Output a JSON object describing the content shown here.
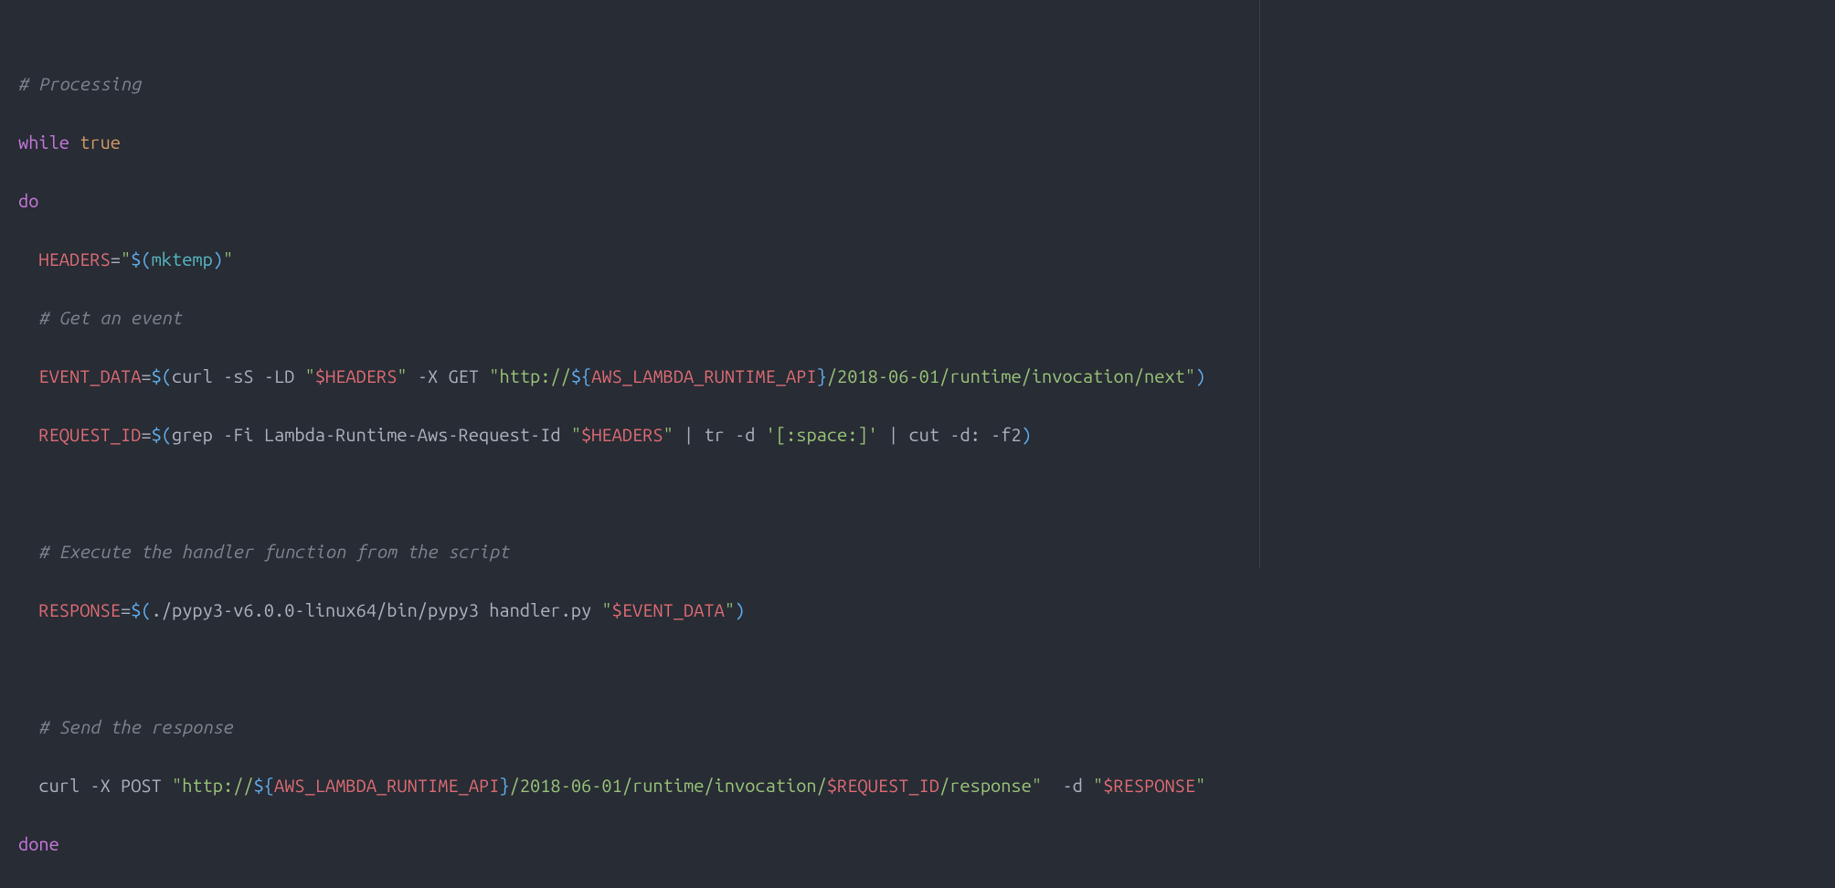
{
  "code": {
    "l1_comment": "# Processing",
    "l2_while": "while",
    "l2_true": "true",
    "l3_do": "do",
    "l4_var": "HEADERS",
    "l4_eq": "=",
    "l4_q1": "\"",
    "l4_sub_open": "$(",
    "l4_cmd": "mktemp",
    "l4_sub_close": ")",
    "l4_q2": "\"",
    "l5_comment": "# Get an event",
    "l6_var": "EVENT_DATA",
    "l6_eq": "=",
    "l6_sub_open": "$(",
    "l6_curl": "curl -sS -LD ",
    "l6_q1": "\"",
    "l6_hdr": "$HEADERS",
    "l6_q2": "\"",
    "l6_mid": " -X GET ",
    "l6_q3": "\"",
    "l6_url1": "http://",
    "l6_interp_open": "${",
    "l6_interp_var": "AWS_LAMBDA_RUNTIME_API",
    "l6_interp_close": "}",
    "l6_url2": "/2018-06-01/runtime/invocation/next",
    "l6_q4": "\"",
    "l6_sub_close": ")",
    "l7_var": "REQUEST_ID",
    "l7_eq": "=",
    "l7_sub_open": "$(",
    "l7_grep": "grep -Fi Lambda-Runtime-Aws-Request-Id ",
    "l7_q1": "\"",
    "l7_hdr": "$HEADERS",
    "l7_q2": "\"",
    "l7_pipe1": " | ",
    "l7_tr": "tr -d ",
    "l7_trarg": "'[:space:]'",
    "l7_pipe2": " | ",
    "l7_cut": "cut -d: -f2",
    "l7_sub_close": ")",
    "l9_comment": "# Execute the handler function from the script",
    "l10_var": "RESPONSE",
    "l10_eq": "=",
    "l10_sub_open": "$(",
    "l10_path": "./pypy3-v6.0.0-linux64/bin/pypy3 handler.py ",
    "l10_q1": "\"",
    "l10_ev": "$EVENT_DATA",
    "l10_q2": "\"",
    "l10_sub_close": ")",
    "l12_comment": "# Send the response",
    "l13_curl": "curl -X POST ",
    "l13_q1": "\"",
    "l13_url1": "http://",
    "l13_interp_open": "${",
    "l13_interp_var": "AWS_LAMBDA_RUNTIME_API",
    "l13_interp_close": "}",
    "l13_url2": "/2018-06-01/runtime/invocation/",
    "l13_reqid": "$REQUEST_ID",
    "l13_url3": "/response",
    "l13_q2": "\"",
    "l13_dflag": "  -d ",
    "l13_q3": "\"",
    "l13_resp": "$RESPONSE",
    "l13_q4": "\"",
    "l14_done": "done"
  }
}
